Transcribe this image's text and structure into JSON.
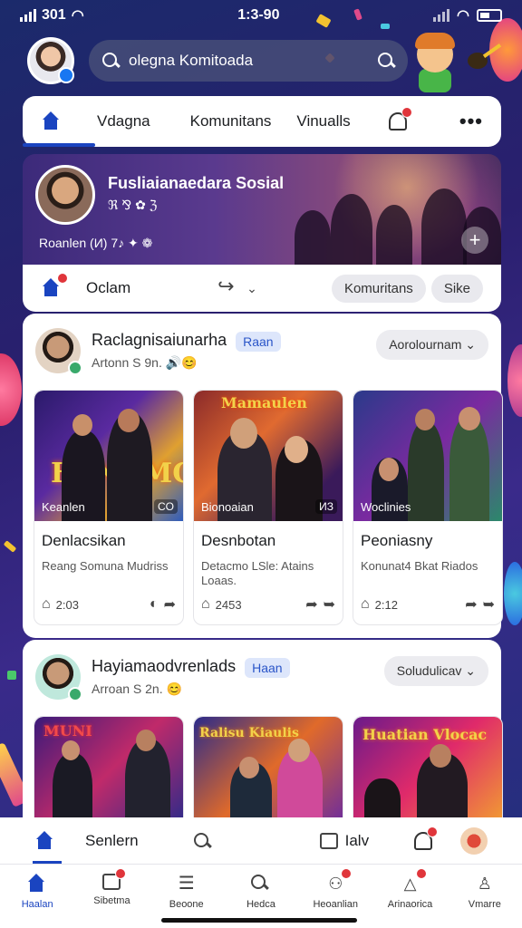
{
  "status": {
    "time_left": "301",
    "time_center": "1:3-90"
  },
  "search": {
    "value": "olegna Komitoada"
  },
  "top_nav": {
    "items": [
      "Vdagna",
      "Komunitans",
      "Vinualls"
    ]
  },
  "banner": {
    "title": "Fusliaianaedara Sosial",
    "subtitle": "ℜ ⅋ ✿ ℨ",
    "meta": "Roanlen  (И) 7♪ ✦ ❁",
    "plus": "+"
  },
  "action_bar": {
    "label": "Oclam",
    "pills": [
      "Komuritans",
      "Sike"
    ]
  },
  "posts": [
    {
      "name": "Raclagnisaiunarha",
      "tag": "Raan",
      "sub": "Artonn S 9n.",
      "dropdown": "Aorolournam",
      "tiles": [
        {
          "caption": "Keanlen",
          "count": "CO",
          "title": "Denlacsikan",
          "desc": "Reang Somuna Mudriss",
          "likes": "2:03"
        },
        {
          "caption": "Bionoaian",
          "count": "ИЗ",
          "title": "Desnbotan",
          "desc": "Detacmo LSle: Atains Loaas.",
          "likes": "2453"
        },
        {
          "caption": "Woclinies",
          "count": "",
          "title": "Peoniasny",
          "desc": "Konunat4 Bkat Riados",
          "likes": "2:12"
        }
      ]
    },
    {
      "name": "Hayiamaodvrenlads",
      "tag": "Haan",
      "sub": "Arroan S 2n.",
      "dropdown": "Soludulicav"
    }
  ],
  "neon_texts": [
    "FUNUMC",
    "Mamaulen",
    "MUNI",
    "Ralisu Kiaulis",
    "Huatian Vlocac"
  ],
  "tabbar": {
    "label": "Senlern",
    "chat": "Ialv"
  },
  "bottom_nav": [
    {
      "label": "Haalan",
      "icon": "home-icon"
    },
    {
      "label": "Sibetma",
      "icon": "store-icon"
    },
    {
      "label": "Beoone",
      "icon": "menu-icon"
    },
    {
      "label": "Hedca",
      "icon": "search-people-icon"
    },
    {
      "label": "Heoanlian",
      "icon": "groups-icon"
    },
    {
      "label": "Arinaorica",
      "icon": "bell-icon"
    },
    {
      "label": "Vmarre",
      "icon": "profile-icon"
    }
  ],
  "colors": {
    "accent": "#1a44c0",
    "badge": "#e0353b",
    "tag_bg": "#dde6fb"
  }
}
